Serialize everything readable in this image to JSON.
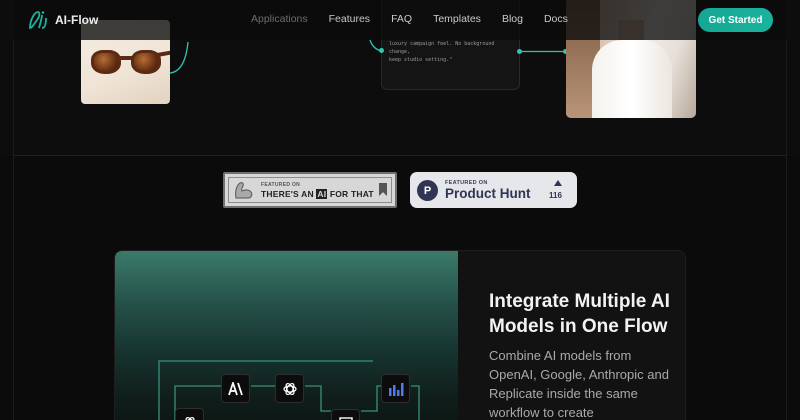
{
  "nav": {
    "brand": "AI-Flow",
    "links": [
      {
        "label": "Applications"
      },
      {
        "label": "Features"
      },
      {
        "label": "FAQ"
      },
      {
        "label": "Templates"
      },
      {
        "label": "Blog"
      },
      {
        "label": "Docs"
      }
    ],
    "cta_label": "Get Started"
  },
  "workflow_preview": {
    "prompt_lines": [
      "luxury campaign feel. No background change,",
      "keep studio setting.\""
    ]
  },
  "badges": {
    "aift": {
      "small": "FEATURED ON",
      "big_before": "THERE'S AN ",
      "big_ai": "AI",
      "big_after": " FOR THAT"
    },
    "product_hunt": {
      "small": "FEATURED ON",
      "big": "Product Hunt",
      "letter": "P",
      "upvotes": "116"
    }
  },
  "feature": {
    "title": "Integrate Multiple AI Models in One Flow",
    "description": "Combine AI models from OpenAI, Google, Anthropic and Replicate inside the same workflow to create"
  },
  "colors": {
    "accent": "#1bb39d",
    "background": "#0b0b0b",
    "ph_navy": "#2f3553"
  }
}
